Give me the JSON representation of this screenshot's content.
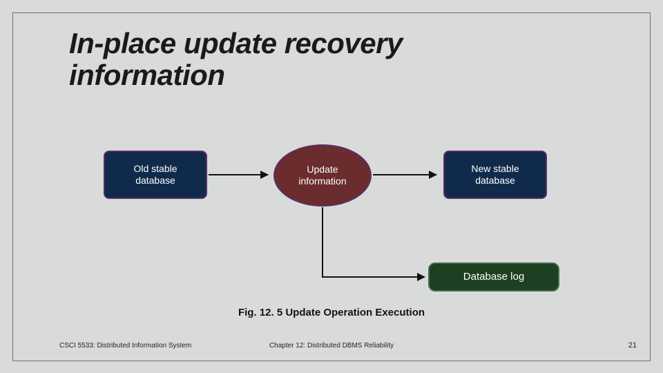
{
  "title": "In-place update recovery information",
  "nodes": {
    "old_db": "Old stable\ndatabase",
    "update": "Update\ninformation",
    "new_db": "New stable\ndatabase",
    "db_log": "Database log"
  },
  "caption": "Fig. 12. 5 Update Operation Execution",
  "footer": {
    "left": "CSCI 5533: Distributed Information System",
    "center": "Chapter 12: Distributed DBMS Reliability",
    "right": "21"
  }
}
